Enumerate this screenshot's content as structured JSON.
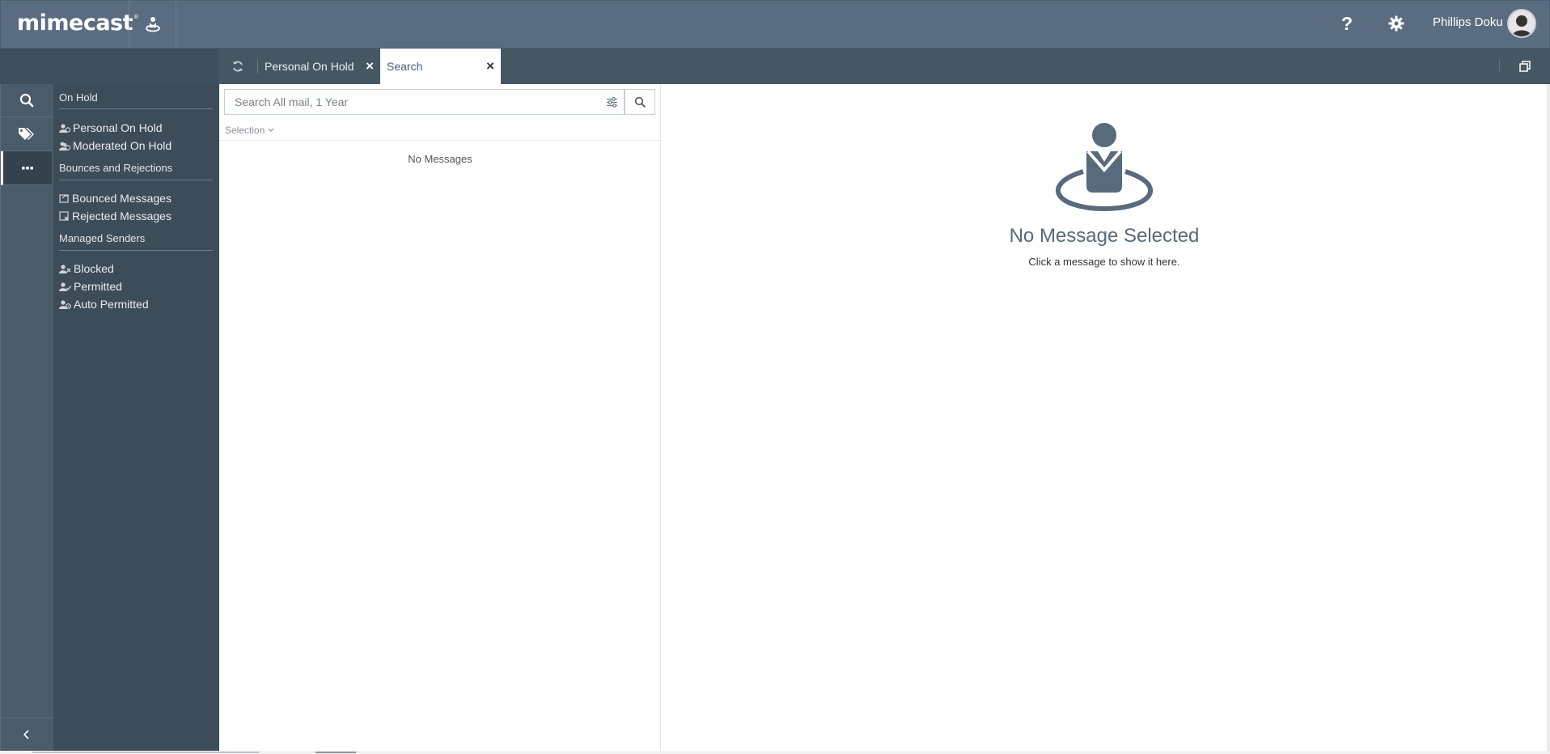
{
  "header": {
    "logo": "mimecast",
    "logo_mark": "®",
    "help_label": "?",
    "username": "Phillips Doku"
  },
  "tabs": [
    {
      "label": "Personal On Hold",
      "close": "×"
    },
    {
      "label": "Search",
      "close": "×",
      "active": true
    }
  ],
  "nav": {
    "sections": [
      {
        "heading": "On Hold",
        "items": [
          {
            "label": "Personal On Hold",
            "icon": "user-hold-icon"
          },
          {
            "label": "Moderated On Hold",
            "icon": "users-hold-icon"
          }
        ]
      },
      {
        "heading": "Bounces and Rejections",
        "items": [
          {
            "label": "Bounced Messages",
            "icon": "bounced-icon"
          },
          {
            "label": "Rejected Messages",
            "icon": "rejected-icon"
          }
        ]
      },
      {
        "heading": "Managed Senders",
        "items": [
          {
            "label": "Blocked",
            "icon": "user-blocked-icon"
          },
          {
            "label": "Permitted",
            "icon": "user-permitted-icon"
          },
          {
            "label": "Auto Permitted",
            "icon": "user-auto-permitted-icon"
          }
        ]
      }
    ]
  },
  "search": {
    "placeholder": "Search All mail, 1 Year",
    "selection_label": "Selection",
    "empty_text": "No Messages"
  },
  "preview": {
    "title": "No Message Selected",
    "hint": "Click a message to show it here."
  },
  "colors": {
    "header_bg": "#5a6d80",
    "tabbar_bg": "#465764",
    "nav_bg": "#3d4c59",
    "rail_bg": "#4a5b69",
    "accent_figure": "#586a7b"
  }
}
